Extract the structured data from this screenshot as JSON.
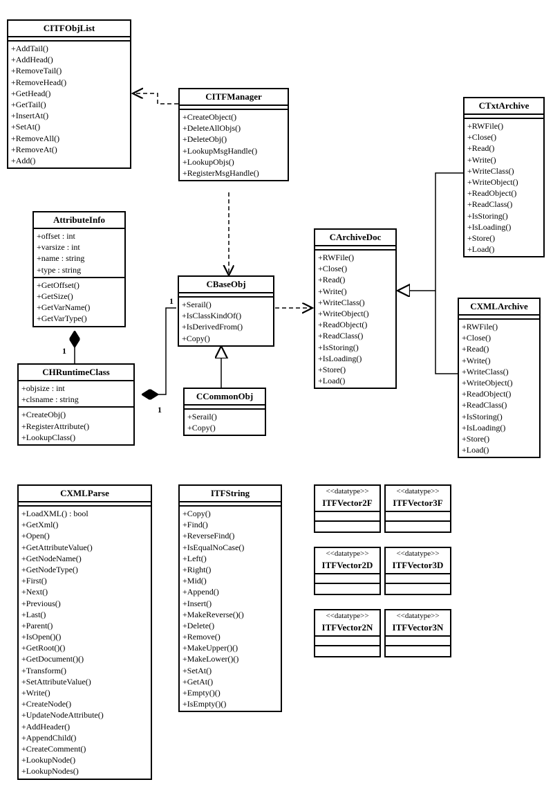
{
  "classes": {
    "citfobjlist": {
      "name": "CITFObjList",
      "attrs": [],
      "ops": [
        "+AddTail()",
        "+AddHead()",
        "+RemoveTail()",
        "+RemoveHead()",
        "+GetHead()",
        "+GetTail()",
        "+InsertAt()",
        "+SetAt()",
        "+RemoveAll()",
        "+RemoveAt()",
        "+Add()"
      ]
    },
    "citfmanager": {
      "name": "CITFManager",
      "attrs": [],
      "ops": [
        "+CreateObject()",
        "+DeleteAllObjs()",
        "+DeleteObj()",
        "+LookupMsgHandle()",
        "+LookupObjs()",
        "+RegisterMsgHandle()"
      ]
    },
    "ctxtarchive": {
      "name": "CTxtArchive",
      "attrs": [],
      "ops": [
        "+RWFile()",
        "+Close()",
        "+Read()",
        "+Write()",
        "+WriteClass()",
        "+WriteObject()",
        "+ReadObject()",
        "+ReadClass()",
        "+IsStoring()",
        "+IsLoading()",
        "+Store()",
        "+Load()"
      ]
    },
    "attributeinfo": {
      "name": "AttributeInfo",
      "attrs": [
        "+offset : int",
        "+varsize : int",
        "+name : string",
        "+type : string"
      ],
      "ops": [
        "+GetOffset()",
        "+GetSize()",
        "+GetVarName()",
        "+GetVarType()"
      ]
    },
    "cbaseobj": {
      "name": "CBaseObj",
      "attrs": [],
      "ops": [
        "+Serail()",
        "+IsClassKindOf()",
        "+IsDerivedFrom()",
        "+Copy()"
      ]
    },
    "carchivedoc": {
      "name": "CArchiveDoc",
      "attrs": [],
      "ops": [
        "+RWFile()",
        "+Close()",
        "+Read()",
        "+Write()",
        "+WriteClass()",
        "+WriteObject()",
        "+ReadObject()",
        "+ReadClass()",
        "+IsStoring()",
        "+IsLoading()",
        "+Store()",
        "+Load()"
      ]
    },
    "cxmlarchive": {
      "name": "CXMLArchive",
      "attrs": [],
      "ops": [
        "+RWFile()",
        "+Close()",
        "+Read()",
        "+Write()",
        "+WriteClass()",
        "+WriteObject()",
        "+ReadObject()",
        "+ReadClass()",
        "+IsStoring()",
        "+IsLoading()",
        "+Store()",
        "+Load()"
      ]
    },
    "chruntimeclass": {
      "name": "CHRuntimeClass",
      "attrs": [
        "+objsize : int",
        "+clsname : string"
      ],
      "ops": [
        "+CreateObj()",
        "+RegisterAttribute()",
        "+LookupClass()"
      ]
    },
    "ccommonobj": {
      "name": "CCommonObj",
      "attrs": [],
      "ops": [
        "+Serail()",
        "+Copy()"
      ]
    },
    "cxmlparse": {
      "name": "CXMLParse",
      "attrs": [],
      "ops": [
        "+LoadXML() : bool",
        "+GetXml()",
        "+Open()",
        "+GetAttributeValue()",
        "+GetNodeName()",
        "+GetNodeType()",
        "+First()",
        "+Next()",
        "+Previous()",
        "+Last()",
        "+Parent()",
        "+IsOpen()()",
        "+GetRoot()()",
        "+GetDocument()()",
        "+Transform()",
        "+SetAttributeValue()",
        "+Write()",
        "+CreateNode()",
        "+UpdateNodeAttribute()",
        "+AddHeader()",
        "+AppendChild()",
        "+CreateComment()",
        "+LookupNode()",
        "+LookupNodes()"
      ]
    },
    "itfstring": {
      "name": "ITFString",
      "attrs": [],
      "ops": [
        "+Copy()",
        "+Find()",
        "+ReverseFind()",
        "+IsEqualNoCase()",
        "+Left()",
        "+Right()",
        "+Mid()",
        "+Append()",
        "+Insert()",
        "+MakeReverse()()",
        "+Delete()",
        "+Remove()",
        "+MakeUpper()()",
        "+MakeLower()()",
        "+SetAt()",
        "+GetAt()",
        "+Empty()()",
        "+IsEmpty()()"
      ]
    },
    "itfvector2f": {
      "stereo": "<<datatype>>",
      "name": "ITFVector2F"
    },
    "itfvector3f": {
      "stereo": "<<datatype>>",
      "name": "ITFVector3F"
    },
    "itfvector2d": {
      "stereo": "<<datatype>>",
      "name": "ITFVector2D"
    },
    "itfvector3d": {
      "stereo": "<<datatype>>",
      "name": "ITFVector3D"
    },
    "itfvector2n": {
      "stereo": "<<datatype>>",
      "name": "ITFVector2N"
    },
    "itfvector3n": {
      "stereo": "<<datatype>>",
      "name": "ITFVector3N"
    }
  },
  "mults": {
    "attr_runtime": "1",
    "runtime_base_left": "1",
    "runtime_base_right": "1"
  }
}
